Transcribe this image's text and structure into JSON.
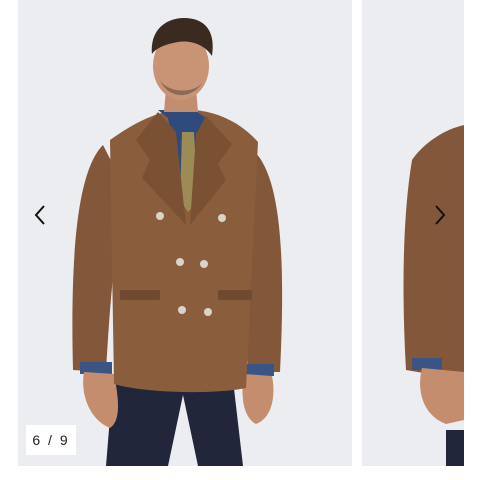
{
  "gallery": {
    "counter": "6 / 9",
    "current_index": 6,
    "total": 9,
    "prev_icon": "chevron-left-icon",
    "next_icon": "chevron-right-icon"
  },
  "colors": {
    "slide_background": "#ecedf0",
    "page_background": "#ffffff",
    "jacket": "#8a5e3c",
    "shirt": "#2f4a7c",
    "tie": "#9c8b55",
    "trousers": "#22263a"
  }
}
